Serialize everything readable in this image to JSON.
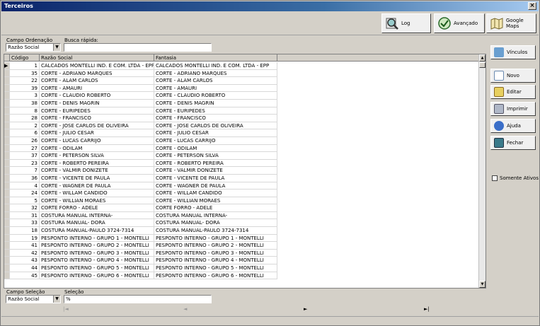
{
  "window": {
    "title": "Terceiros"
  },
  "toolbar": {
    "log_label": "Log",
    "avancado_label": "Avançado",
    "maps_label": "Google Maps"
  },
  "filters": {
    "ordenacao_label": "Campo Ordenação",
    "ordenacao_value": "Razão Social",
    "busca_label": "Busca rápida:",
    "busca_value": ""
  },
  "grid": {
    "headers": [
      "Código",
      "Razão Social",
      "Fantasia"
    ],
    "rows": [
      [
        "1",
        "CALCADOS MONTELLI IND. E COM. LTDA - EPP",
        "CALCADOS MONTELLI IND. E COM. LTDA - EPP"
      ],
      [
        "35",
        "CORTE - ADRIANO MARQUES",
        "CORTE - ADRIANO MARQUES"
      ],
      [
        "22",
        "CORTE - ALAM CARLOS",
        "CORTE - ALAM CARLOS"
      ],
      [
        "39",
        "CORTE - AMAURI",
        "CORTE - AMAURI"
      ],
      [
        "3",
        "CORTE - CLAUDIO ROBERTO",
        "CORTE - CLAUDIO ROBERTO"
      ],
      [
        "38",
        "CORTE - DENIS MAGRIN",
        "CORTE - DENIS MAGRIN"
      ],
      [
        "8",
        "CORTE - EURIPEDES",
        "CORTE - EURIPEDES"
      ],
      [
        "28",
        "CORTE - FRANCISCO",
        "CORTE - FRANCISCO"
      ],
      [
        "2",
        "CORTE - JOSE CARLOS DE OLIVEIRA",
        "CORTE - JOSE CARLOS DE OLIVEIRA"
      ],
      [
        "6",
        "CORTE - JULIO CESAR",
        "CORTE - JULIO CESAR"
      ],
      [
        "26",
        "CORTE - LUCAS CARRIJO",
        "CORTE - LUCAS CARRIJO"
      ],
      [
        "27",
        "CORTE - ODILAM",
        "CORTE - ODILAM"
      ],
      [
        "37",
        "CORTE - PETERSON SILVA",
        "CORTE - PETERSON SILVA"
      ],
      [
        "23",
        "CORTE - ROBERTO PEREIRA",
        "CORTE - ROBERTO PEREIRA"
      ],
      [
        "7",
        "CORTE - VALMIR DONIZETE",
        "CORTE - VALMIR DONIZETE"
      ],
      [
        "36",
        "CORTE - VICENTE DE PAULA",
        "CORTE - VICENTE DE PAULA"
      ],
      [
        "4",
        "CORTE - WAGNER DE PAULA",
        "CORTE - WAGNER DE PAULA"
      ],
      [
        "24",
        "CORTE - WILLAM CANDIDO",
        "CORTE - WILLAM CANDIDO"
      ],
      [
        "5",
        "CORTE - WILLIAN MORAES",
        "CORTE - WILLIAN MORAES"
      ],
      [
        "32",
        "CORTE FORRO - ADELE",
        "CORTE FORRO - ADELE"
      ],
      [
        "31",
        "COSTURA MANUAL INTERNA-",
        "COSTURA MANUAL INTERNA-"
      ],
      [
        "33",
        "COSTURA MANUAL- DORA",
        "COSTURA MANUAL- DORA"
      ],
      [
        "18",
        "COSTURA MANUAL-PAULO 3724-7314",
        "COSTURA MANUAL-PAULO 3724-7314"
      ],
      [
        "19",
        "PESPONTO INTERNO - GRUPO 1 - MONTELLI",
        "PESPONTO INTERNO - GRUPO 1 - MONTELLI"
      ],
      [
        "41",
        "PESPONTO INTERNO - GRUPO 2 - MONTELLI",
        "PESPONTO INTERNO - GRUPO 2 - MONTELLI"
      ],
      [
        "42",
        "PESPONTO INTERNO - GRUPO 3 - MONTELLI",
        "PESPONTO INTERNO - GRUPO 3 - MONTELLI"
      ],
      [
        "43",
        "PESPONTO INTERNO - GRUPO 4 - MONTELLI",
        "PESPONTO INTERNO - GRUPO 4 - MONTELLI"
      ],
      [
        "44",
        "PESPONTO INTERNO - GRUPO 5 - MONTELLI",
        "PESPONTO INTERNO - GRUPO 5 - MONTELLI"
      ],
      [
        "45",
        "PESPONTO INTERNO - GRUPO 6 - MONTELLI",
        "PESPONTO INTERNO - GRUPO 6 - MONTELLI"
      ]
    ]
  },
  "sidebar": {
    "vinculos": "Vínculos",
    "novo": "Novo",
    "editar": "Editar",
    "imprimir": "Imprimir",
    "ajuda": "Ajuda",
    "fechar": "Fechar",
    "somente_ativos": "Somente Ativos"
  },
  "bottom": {
    "selecao_campo_label": "Campo Seleção",
    "selecao_campo_value": "Razão Social",
    "selecao_label": "Seleção",
    "selecao_value": "%"
  },
  "nav": {
    "first": "|◄",
    "prev": "◄",
    "next": "►",
    "last": "►|"
  }
}
